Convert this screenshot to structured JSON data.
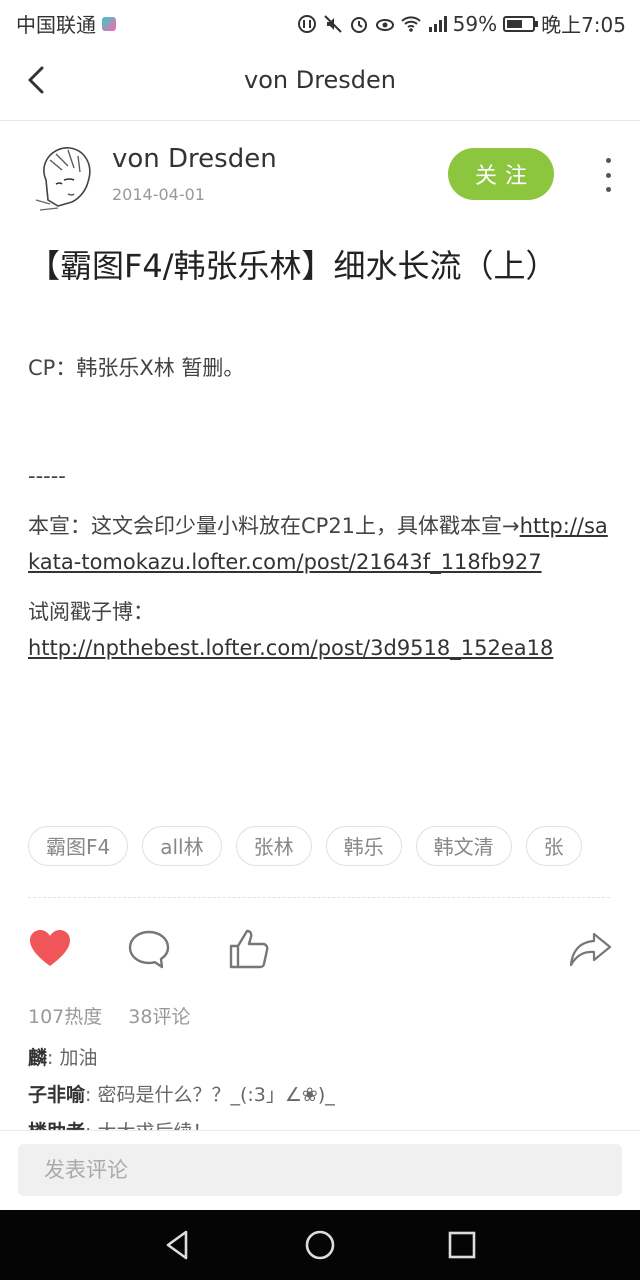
{
  "status_bar": {
    "carrier": "中国联通",
    "battery": "59%",
    "time": "晚上7:05"
  },
  "nav": {
    "title": "von Dresden"
  },
  "author": {
    "name": "von Dresden",
    "date": "2014-04-01",
    "follow_label": "关注"
  },
  "post": {
    "title": "【霸图F4/韩张乐林】细水长流（上）",
    "cp_line": "CP：韩张乐X林 暂删。",
    "separator": "-----",
    "promo_text": "本宣：这文会印少量小料放在CP21上，具体戳本宣→",
    "promo_link": "http://sakata-tomokazu.lofter.com/post/21643f_118fb927",
    "trial_text": "试阅戳子博：",
    "trial_link": "http://npthebest.lofter.com/post/3d9518_152ea18"
  },
  "tags": [
    "霸图F4",
    "all林",
    "张林",
    "韩乐",
    "韩文清",
    "张"
  ],
  "stats": {
    "heat": "107热度",
    "comments": "38评论"
  },
  "comment_preview": [
    {
      "user": "麟",
      "text": ": 加油"
    },
    {
      "user": "子非喻",
      "text": ": 密码是什么？？_(:3」∠❀)_"
    },
    {
      "user": "楼助者",
      "text": ": 大大求后续！"
    }
  ],
  "comment_input": {
    "placeholder": "发表评论"
  },
  "colors": {
    "accent_green": "#8cc63f",
    "like_red": "#f0555a",
    "system_nav": "#050505"
  }
}
